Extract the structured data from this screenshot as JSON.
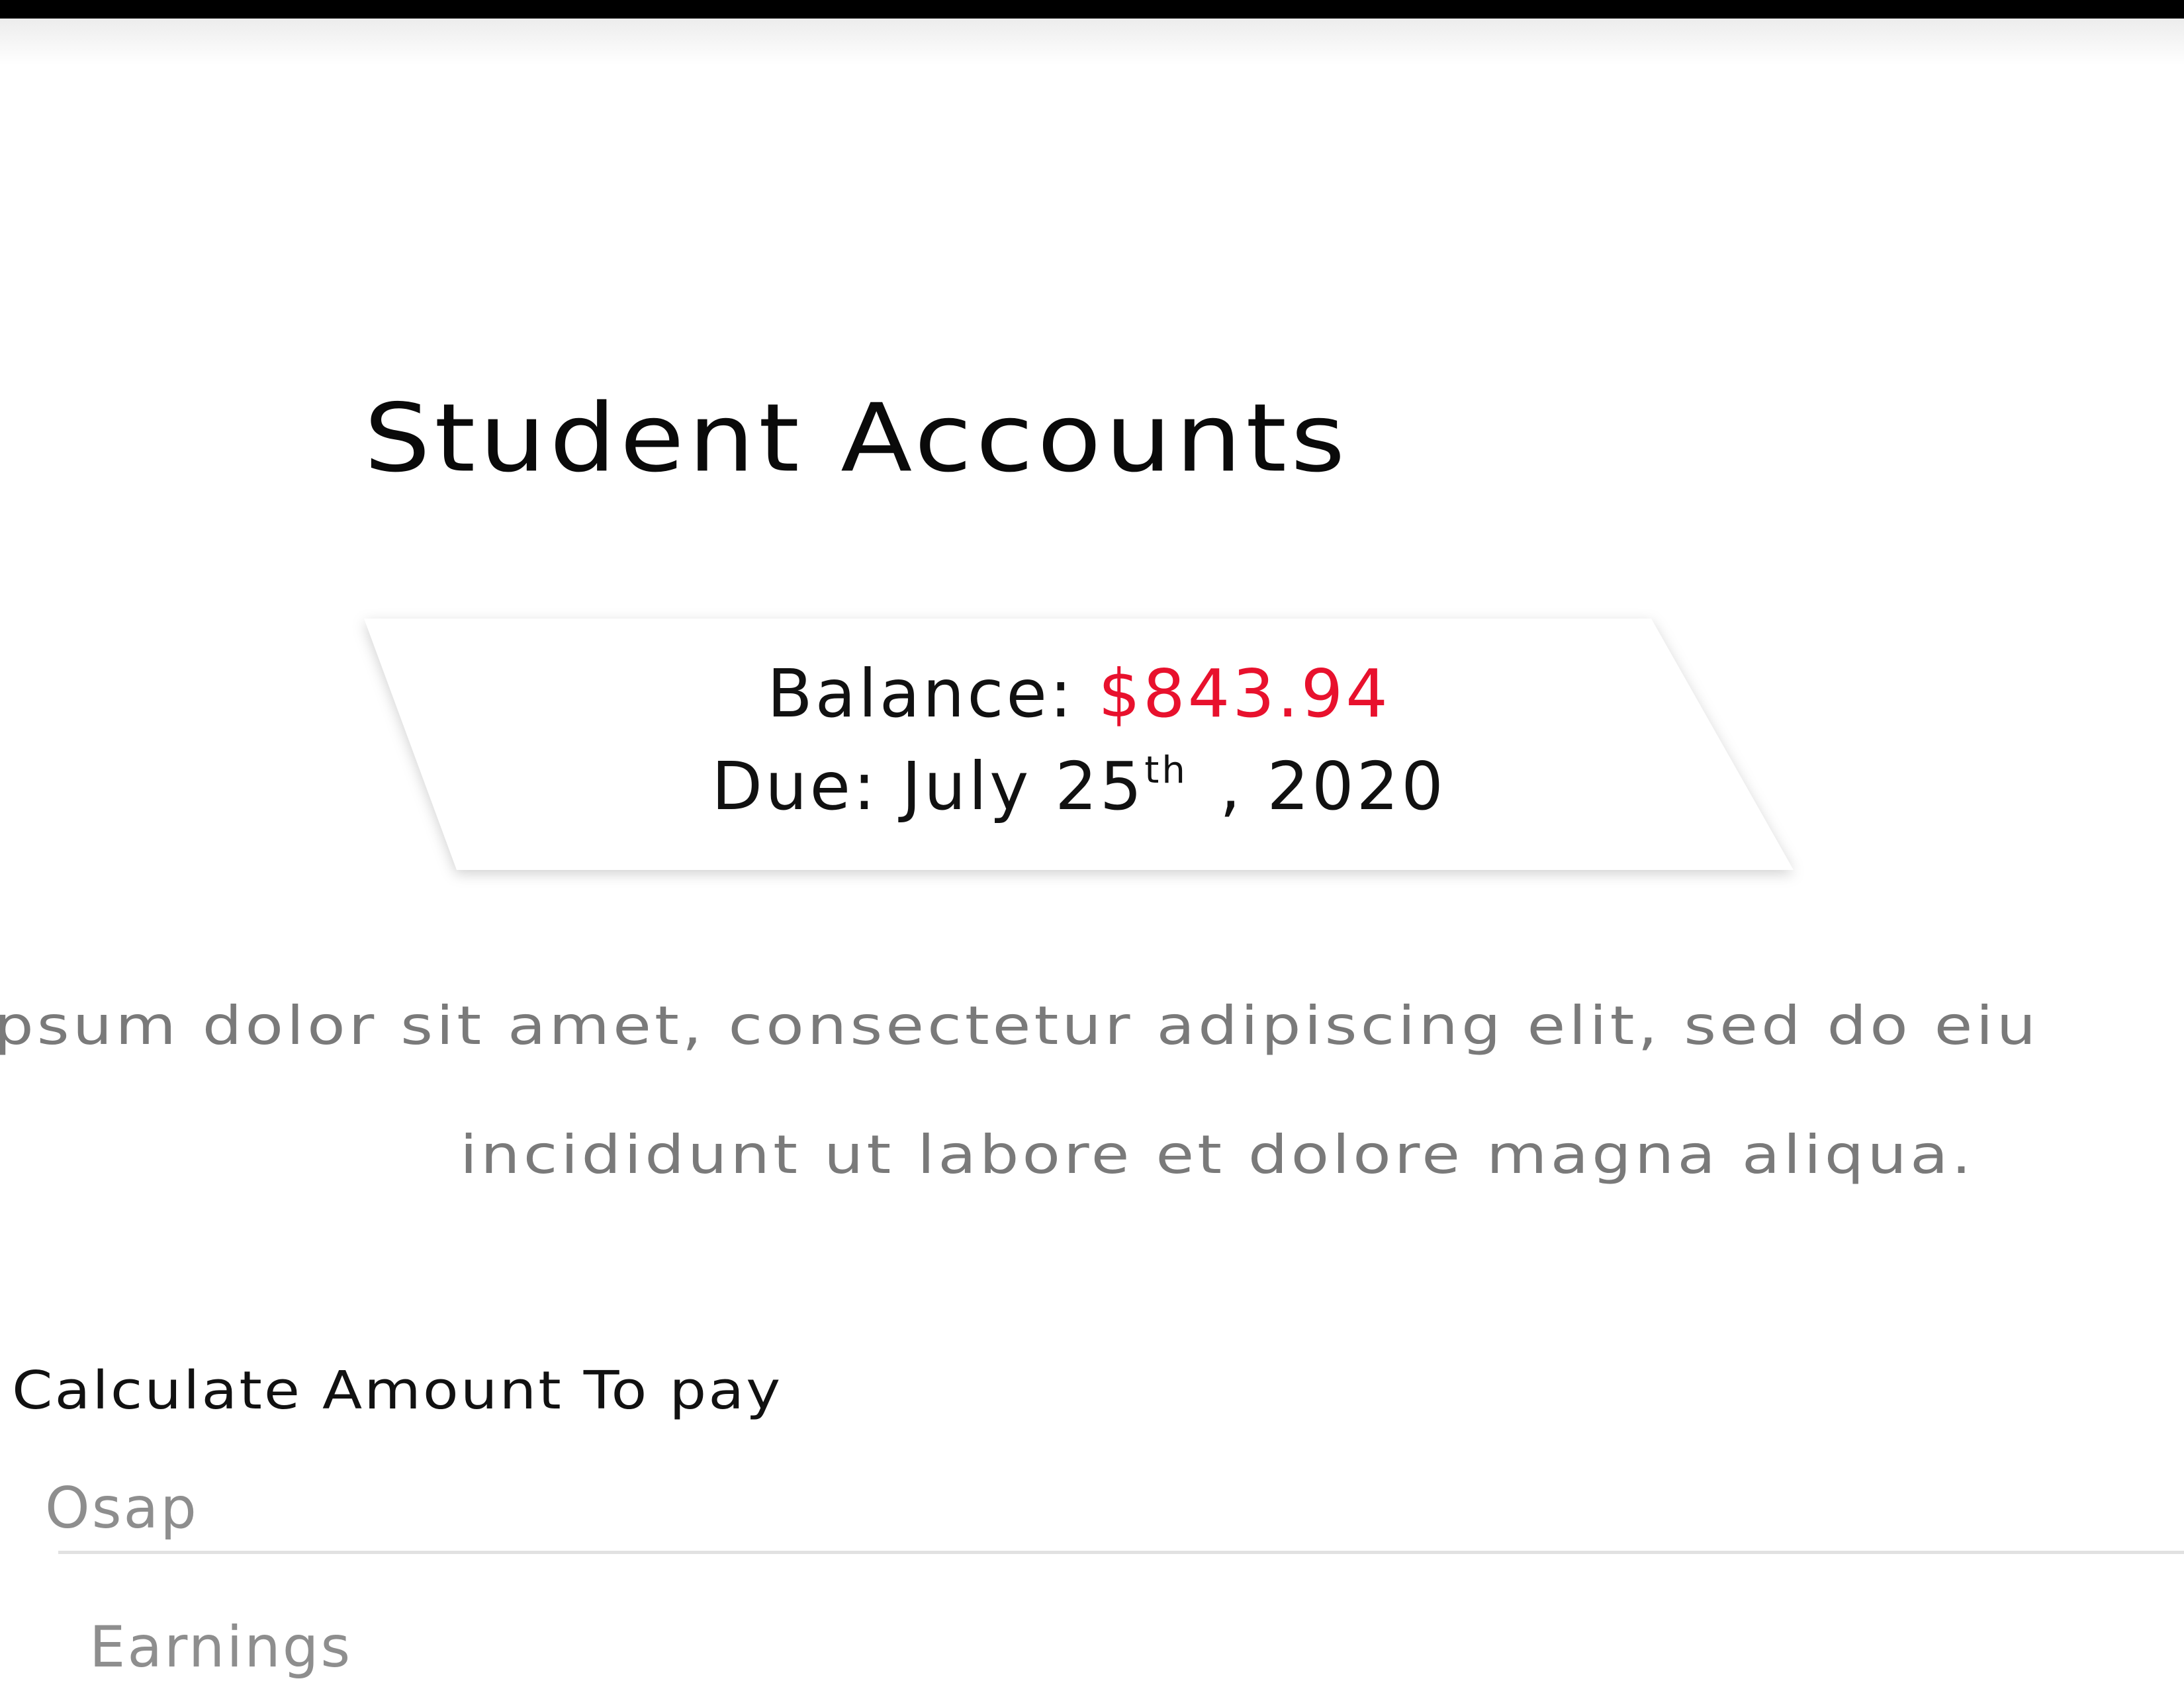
{
  "header": {
    "title": "Student Accounts"
  },
  "balance_card": {
    "balance_label": "Balance:",
    "balance_amount": "$843.94",
    "due_label": "Due: July 25",
    "due_suffix": "th",
    "due_year": ", 2020",
    "amount_color": "#e8112d"
  },
  "description": {
    "line1": "ipsum dolor sit amet, consectetur adipiscing elit, sed do eiu",
    "line2": "incididunt ut labore et dolore magna aliqua."
  },
  "calculator": {
    "label": "Calculate Amount To pay",
    "osap_placeholder": "Osap",
    "earnings_placeholder": "Earnings"
  }
}
